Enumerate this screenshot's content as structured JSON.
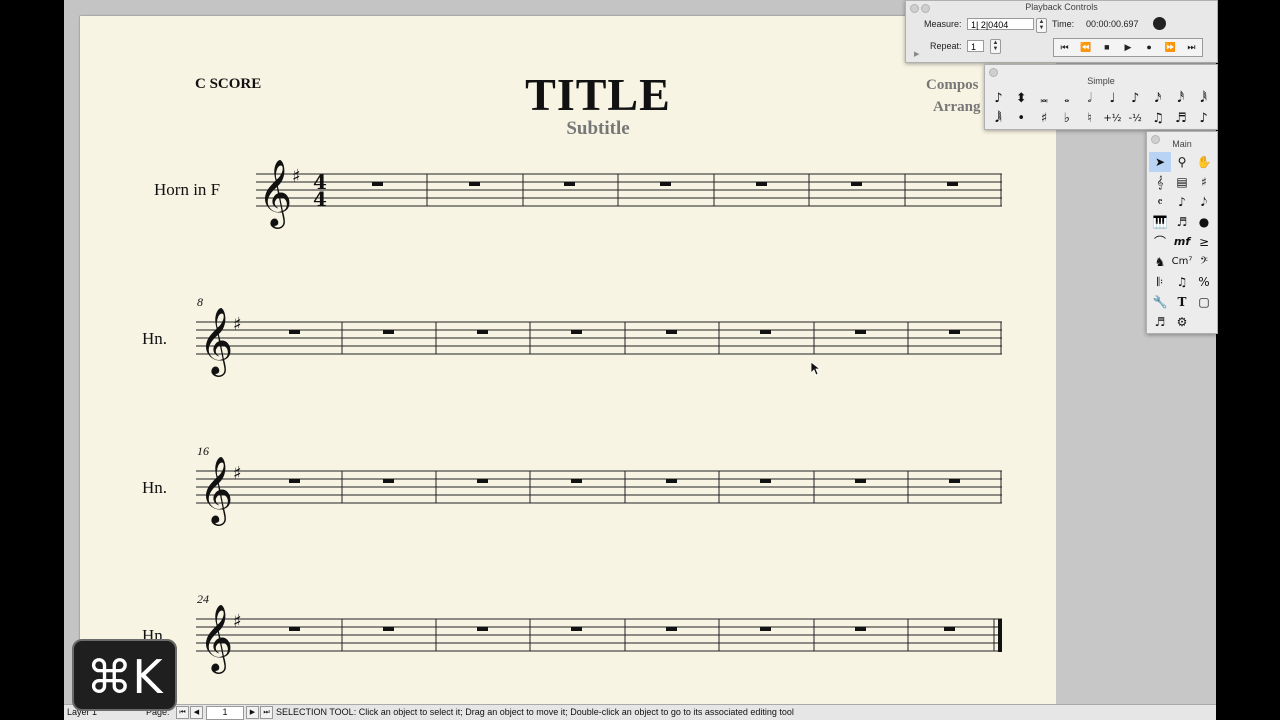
{
  "score": {
    "header_left": "C SCORE",
    "title": "TITLE",
    "subtitle": "Subtitle",
    "composer": "Compos",
    "arranger": "Arrang"
  },
  "staves": [
    {
      "name": "Horn in F",
      "measure_number": ""
    },
    {
      "name": "Hn.",
      "measure_number": "8"
    },
    {
      "name": "Hn.",
      "measure_number": "16"
    },
    {
      "name": "Hn.",
      "measure_number": "24"
    }
  ],
  "playback": {
    "window_title": "Playback Controls",
    "measure_label": "Measure:",
    "measure_value": "1| 2|0404",
    "time_label": "Time:",
    "time_value": "00:00:00.697",
    "repeat_label": "Repeat:",
    "repeat_value": "1"
  },
  "simple_palette": {
    "title": "Simple"
  },
  "main_palette": {
    "title": "Main"
  },
  "status_bar": {
    "layer_label": "Layer 1",
    "page_label": "Page:",
    "page_value": "1",
    "message": "SELECTION TOOL: Click an object to select it; Drag an object to move it; Double-click an object to go to its associated editing tool"
  },
  "shortcut_overlay": {
    "text": "⌘K"
  },
  "colors": {
    "paper": "#f7f4e4",
    "background": "#c4c4c4",
    "selected_tool": "#b9d3f5"
  }
}
